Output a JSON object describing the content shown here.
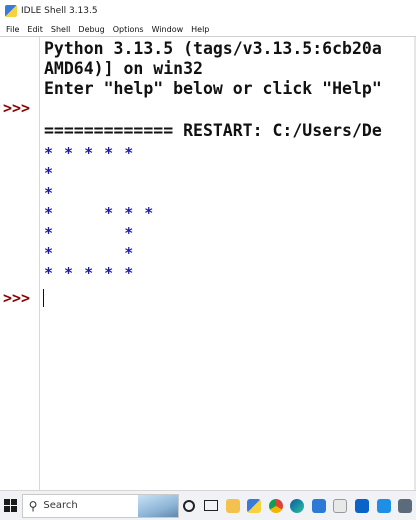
{
  "window": {
    "title": "IDLE Shell 3.13.5"
  },
  "menu": {
    "items": [
      "File",
      "Edit",
      "Shell",
      "Debug",
      "Options",
      "Window",
      "Help"
    ]
  },
  "shell": {
    "banner_lines": [
      "Python 3.13.5 (tags/v3.13.5:6cb20a",
      "AMD64)] on win32",
      "Enter \"help\" below or click \"Help\""
    ],
    "restart_line": "============= RESTART: C:/Users/De",
    "output_lines": [
      "* * * * *",
      "*",
      "*",
      "*     * * *",
      "*       *",
      "*       *",
      "* * * * *"
    ],
    "prompt": ">>>"
  },
  "taskbar": {
    "search_placeholder": "Search",
    "icons": [
      "windows-start-icon",
      "search-icon",
      "cortana-icon",
      "task-view-icon",
      "file-explorer-icon",
      "idle-icon",
      "chrome-icon",
      "edge-icon",
      "photos-icon",
      "store-icon",
      "outlook-icon",
      "mail-icon",
      "app-icon"
    ]
  }
}
